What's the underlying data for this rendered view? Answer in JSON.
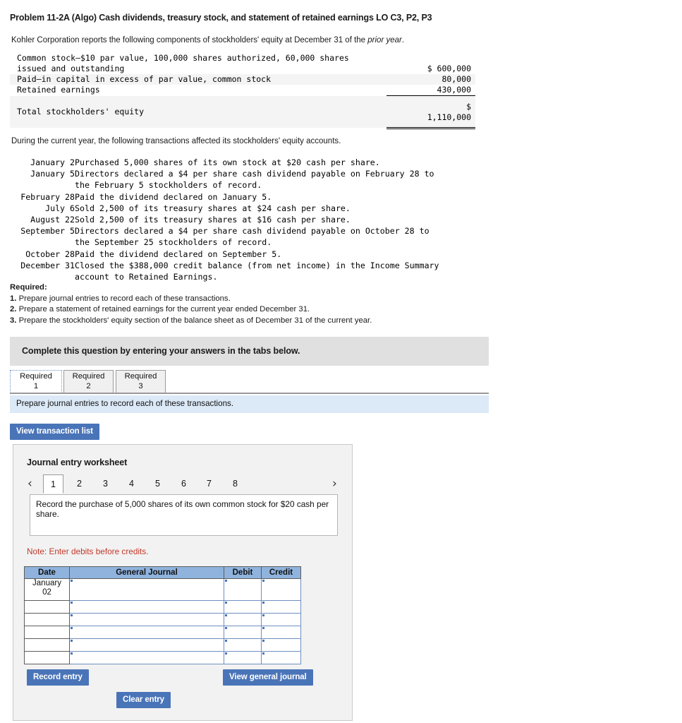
{
  "problem": {
    "title": "Problem 11-2A (Algo) Cash dividends, treasury stock, and statement of retained earnings LO C3, P2, P3",
    "intro_prefix": "Kohler Corporation reports the following components of stockholders' equity at December 31 of the ",
    "intro_italic": "prior year",
    "intro_suffix": "."
  },
  "equity_table": {
    "rows": [
      {
        "label": "Common stock—$10 par value, 100,000 shares authorized, 60,000 shares\nissued and outstanding",
        "amount": "$ 600,000"
      },
      {
        "label": "Paid—in capital in excess of par value, common stock",
        "amount": "80,000"
      },
      {
        "label": "Retained earnings",
        "amount": "430,000"
      }
    ],
    "total_label": "Total stockholders' equity",
    "total_amount": "$\n1,110,000"
  },
  "during_year_line": "During the current year, the following transactions affected its stockholders' equity accounts.",
  "transactions": [
    {
      "date": "January 2",
      "desc": "Purchased 5,000 shares of its own stock at $20 cash per share."
    },
    {
      "date": "January 5",
      "desc": "Directors declared a $4 per share cash dividend payable on February 28 to\nthe February 5 stockholders of record."
    },
    {
      "date": "February 28",
      "desc": "Paid the dividend declared on January 5."
    },
    {
      "date": "July 6",
      "desc": "Sold 2,500 of its treasury shares at $24 cash per share."
    },
    {
      "date": "August 22",
      "desc": "Sold 2,500 of its treasury shares at $16 cash per share."
    },
    {
      "date": "September 5",
      "desc": "Directors declared a $4 per share cash dividend payable on October 28 to\nthe September 25 stockholders of record."
    },
    {
      "date": "October 28",
      "desc": "Paid the dividend declared on September 5."
    },
    {
      "date": "December 31",
      "desc": "Closed the $388,000 credit balance (from net income) in the Income Summary\naccount to Retained Earnings."
    }
  ],
  "required": {
    "heading": "Required:",
    "items": [
      {
        "num": "1.",
        "text": "Prepare journal entries to record each of these transactions."
      },
      {
        "num": "2.",
        "text": "Prepare a statement of retained earnings for the current year ended December 31."
      },
      {
        "num": "3.",
        "text": "Prepare the stockholders' equity section of the balance sheet as of December 31 of the current year."
      }
    ]
  },
  "complete_banner": "Complete this question by entering your answers in the tabs below.",
  "tabs": [
    {
      "line1": "Required",
      "line2": "1",
      "active": true
    },
    {
      "line1": "Required",
      "line2": "2",
      "active": false
    },
    {
      "line1": "Required",
      "line2": "3",
      "active": false
    }
  ],
  "instruction": "Prepare journal entries to record each of these transactions.",
  "buttons": {
    "view_transaction_list": "View transaction list",
    "record_entry": "Record entry",
    "clear_entry": "Clear entry",
    "view_general_journal": "View general journal"
  },
  "worksheet": {
    "title": "Journal entry worksheet",
    "pager": {
      "prev_icon": "chevron-left",
      "next_icon": "chevron-right",
      "prev_glyph": "‹",
      "next_glyph": "›",
      "pages": [
        "1",
        "2",
        "3",
        "4",
        "5",
        "6",
        "7",
        "8"
      ],
      "active_page": "1"
    },
    "prompt": "Record the purchase of 5,000 shares of its own common stock for $20 cash per share.",
    "note": "Note: Enter debits before credits.",
    "journal": {
      "headers": [
        "Date",
        "General Journal",
        "Debit",
        "Credit"
      ],
      "rows": [
        {
          "date": "January\n02",
          "general_journal": "",
          "debit": "",
          "credit": ""
        },
        {
          "date": "",
          "general_journal": "",
          "debit": "",
          "credit": ""
        },
        {
          "date": "",
          "general_journal": "",
          "debit": "",
          "credit": ""
        },
        {
          "date": "",
          "general_journal": "",
          "debit": "",
          "credit": ""
        },
        {
          "date": "",
          "general_journal": "",
          "debit": "",
          "credit": ""
        },
        {
          "date": "",
          "general_journal": "",
          "debit": "",
          "credit": ""
        }
      ]
    }
  },
  "colors": {
    "button_blue": "#4a74b8",
    "table_header_blue": "#8fb3dd",
    "instruction_blue": "#dce9f7",
    "banner_gray": "#e0e0e0",
    "panel_gray": "#f2f2f2",
    "note_red": "#c0392b"
  }
}
